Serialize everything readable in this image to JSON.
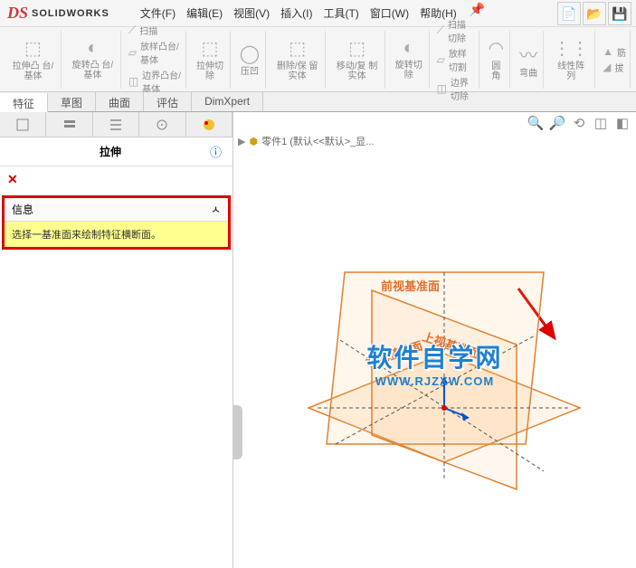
{
  "app": {
    "logo_s": "DS",
    "logo_text": "SOLIDWORKS"
  },
  "menu": {
    "file": "文件(F)",
    "edit": "编辑(E)",
    "view": "视图(V)",
    "insert": "插入(I)",
    "tools": "工具(T)",
    "window": "窗口(W)",
    "help": "帮助(H)"
  },
  "ribbon": {
    "extrude": "拉伸凸\n台/基体",
    "revolve": "旋转凸\n台/基体",
    "sweep": "扫描",
    "loft": "放样凸台/基体",
    "boundary": "边界凸台/基体",
    "extrude_cut": "拉伸切\n除",
    "hole": "压凹",
    "delete_keep": "删除/保\n留实体",
    "move_copy": "移动/复\n制实体",
    "revolve_cut": "旋转切\n除",
    "sweep_cut": "扫描切除",
    "loft_cut": "放样切割",
    "boundary_cut": "边界切除",
    "fillet": "圆角",
    "curve": "弯曲",
    "linear_pattern": "线性阵\n列",
    "rib": "筋",
    "draft": "拔"
  },
  "tabs": {
    "feature": "特征",
    "sketch": "草图",
    "surface": "曲面",
    "evaluate": "评估",
    "dimxpert": "DimXpert"
  },
  "panel": {
    "title": "拉伸",
    "info_label": "信息",
    "info_msg": "选择一基准面来绘制特征横断面。"
  },
  "breadcrumb": {
    "part": "零件1 (默认<<默认>_显..."
  },
  "planes": {
    "front": "前视基准面",
    "top": "上视基准面",
    "right": "右视基准面"
  },
  "watermark": {
    "line1": "软件自学网",
    "line2": "WWW.RJZXW.COM"
  }
}
